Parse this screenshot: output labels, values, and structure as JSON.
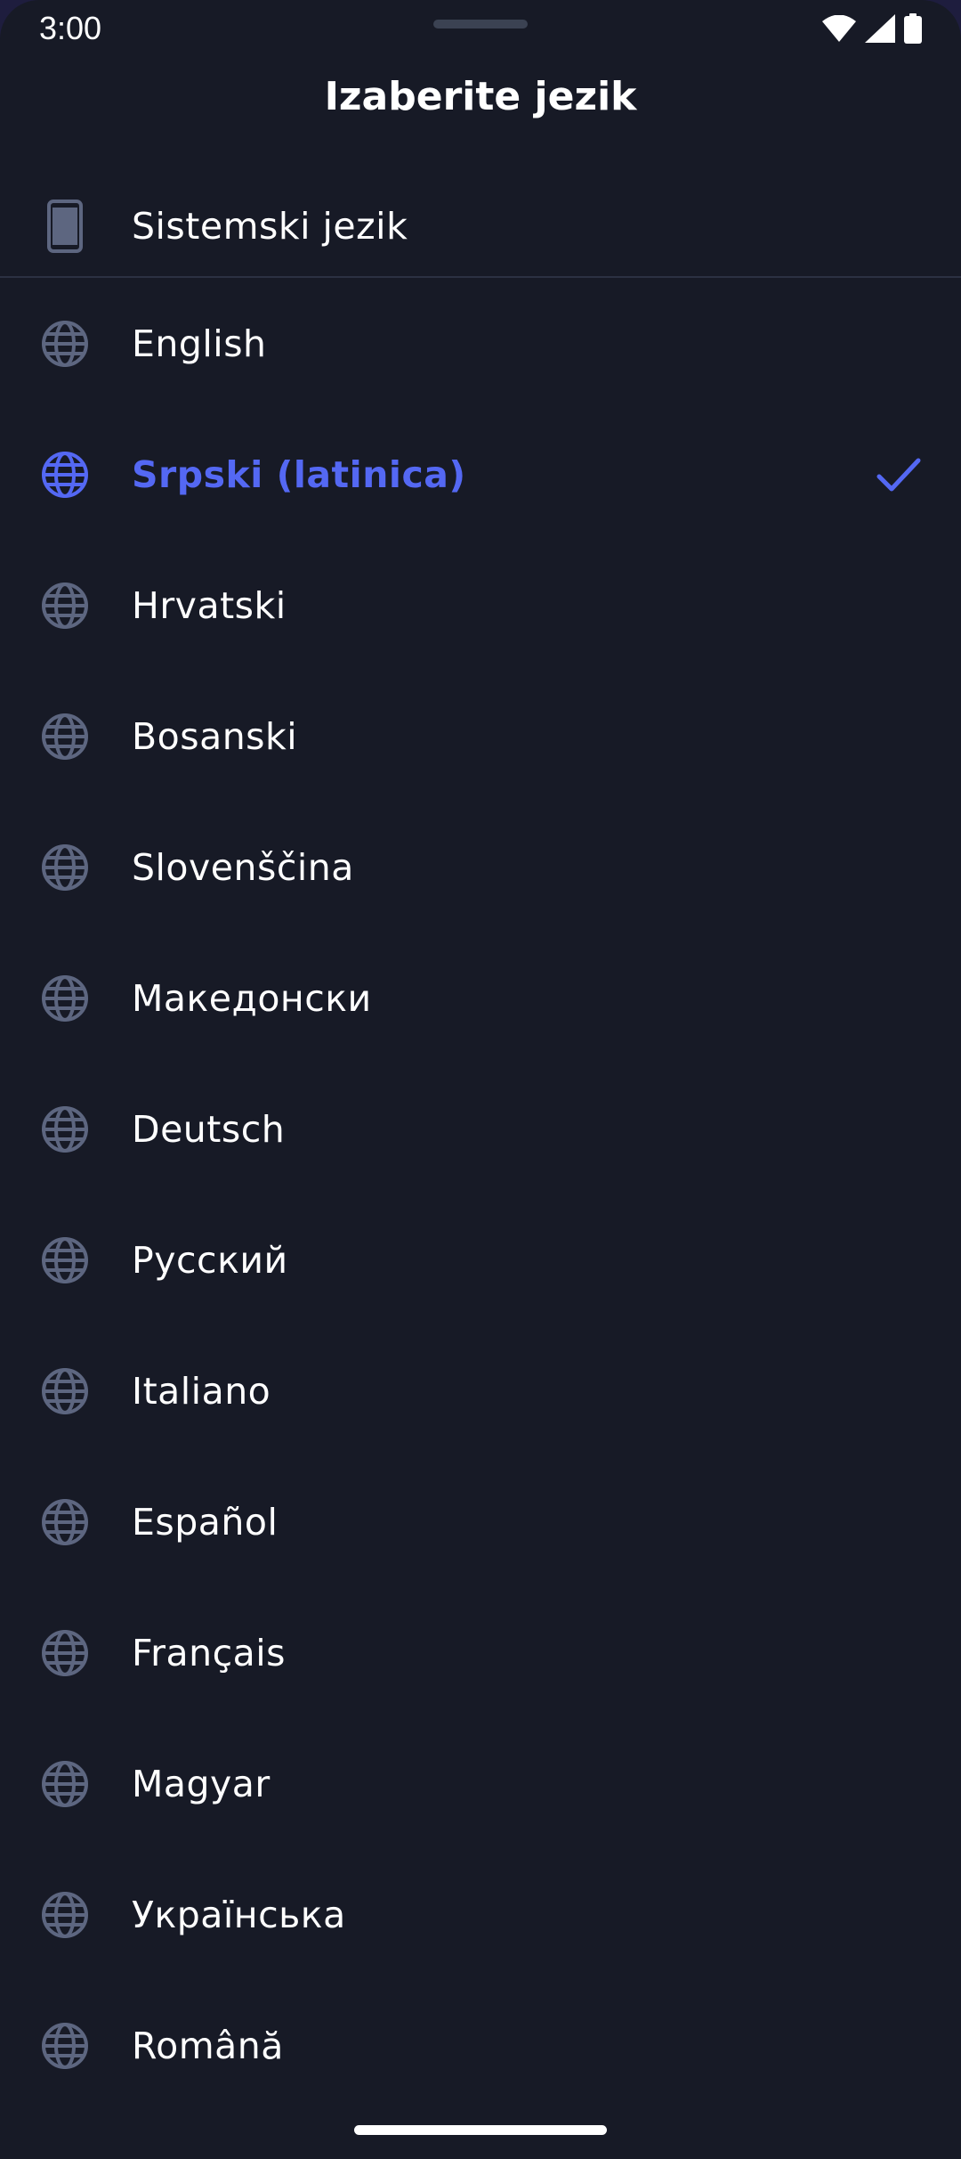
{
  "status_bar": {
    "time": "3:00"
  },
  "header": {
    "title": "Izaberite jezik"
  },
  "system_language": {
    "label": "Sistemski jezik",
    "icon": "smartphone-icon"
  },
  "languages": [
    {
      "label": "English",
      "icon": "globe-icon",
      "selected": false
    },
    {
      "label": "Srpski (latinica)",
      "icon": "globe-icon",
      "selected": true
    },
    {
      "label": "Hrvatski",
      "icon": "globe-icon",
      "selected": false
    },
    {
      "label": "Bosanski",
      "icon": "globe-icon",
      "selected": false
    },
    {
      "label": "Slovenščina",
      "icon": "globe-icon",
      "selected": false
    },
    {
      "label": "Македонски",
      "icon": "globe-icon",
      "selected": false
    },
    {
      "label": "Deutsch",
      "icon": "globe-icon",
      "selected": false
    },
    {
      "label": "Русский",
      "icon": "globe-icon",
      "selected": false
    },
    {
      "label": "Italiano",
      "icon": "globe-icon",
      "selected": false
    },
    {
      "label": "Español",
      "icon": "globe-icon",
      "selected": false
    },
    {
      "label": "Français",
      "icon": "globe-icon",
      "selected": false
    },
    {
      "label": "Magyar",
      "icon": "globe-icon",
      "selected": false
    },
    {
      "label": "Українська",
      "icon": "globe-icon",
      "selected": false
    },
    {
      "label": "Română",
      "icon": "globe-icon",
      "selected": false
    }
  ],
  "colors": {
    "background": "#171a26",
    "accent": "#5468f3",
    "icon": "#5d6680",
    "text": "#ffffff"
  }
}
